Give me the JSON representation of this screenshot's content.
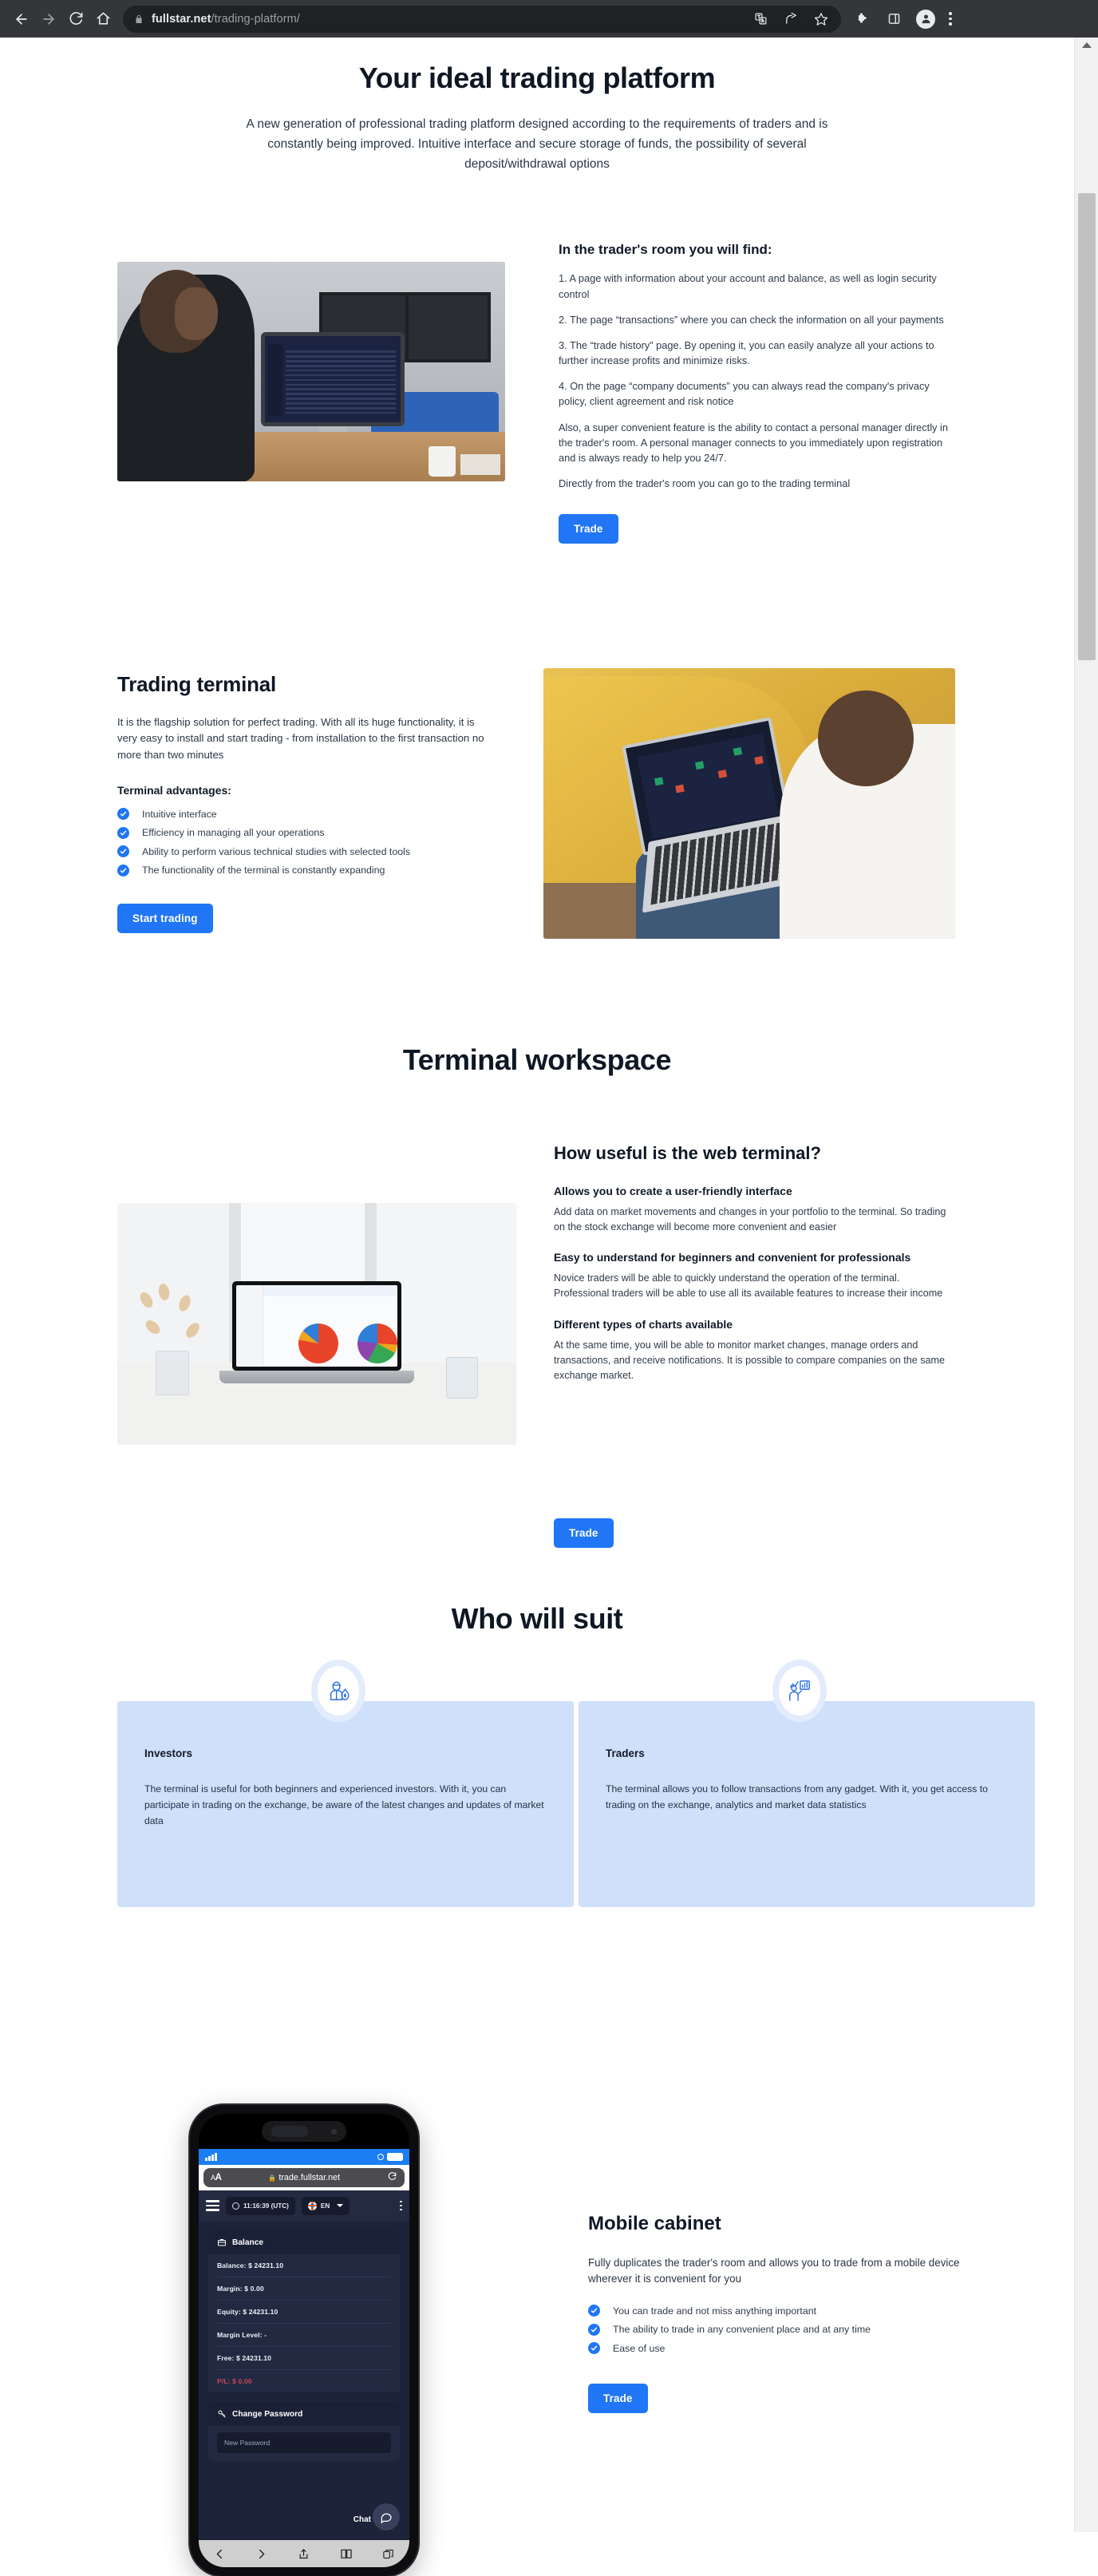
{
  "browser": {
    "back_icon": "arrow-left-icon",
    "forward_icon": "arrow-right-icon",
    "reload_icon": "reload-icon",
    "home_icon": "home-icon",
    "lock_icon": "lock-icon",
    "url_host": "fullstar.net",
    "url_path": "/trading-platform/",
    "toolbar_icons": [
      "translate-icon",
      "share-icon",
      "bookmark-star-icon",
      "extensions-puzzle-icon",
      "side-panel-icon",
      "profile-avatar-icon",
      "browser-menu-icon"
    ]
  },
  "hero": {
    "title": "Your ideal trading platform",
    "subtitle": "A new generation of professional trading platform designed according to the requirements of traders and is constantly being improved. Intuitive interface and secure storage of funds, the possibility of several deposit/withdrawal options"
  },
  "traders_room": {
    "image_alt": "man-at-desk-with-trading-terminal-photo",
    "heading": "In the trader's room you will find:",
    "paragraphs": [
      "1. A page with information about your account and balance, as well as login security control",
      "2. The page “transactions” where you can check the information on all your payments",
      "3. The “trade history” page. By opening it, you can easily analyze all your actions to further increase profits and minimize risks.",
      "4. On the page “company documents” you can always read the company's privacy policy, client agreement and risk notice",
      "Also, a super convenient feature is the ability to contact a personal manager directly in the trader's room. A personal manager connects to you immediately upon registration and is always ready to help you 24/7.",
      "Directly from the trader's room you can go to the trading terminal"
    ],
    "cta": "Trade"
  },
  "trading_terminal": {
    "title": "Trading terminal",
    "description": "It is the flagship solution for perfect trading. With all its huge functionality, it is very easy to install and start trading - from installation to the first transaction no more than two minutes",
    "advantages_title": "Terminal advantages:",
    "advantages": [
      "Intuitive interface",
      "Efficiency in managing all your operations",
      "Ability to perform various technical studies with selected tools",
      "The functionality of the terminal is constantly expanding"
    ],
    "cta": "Start trading",
    "image_alt": "boy-on-bed-with-laptop-trading-charts-photo"
  },
  "workspace": {
    "title": "Terminal workspace",
    "image_alt": "laptop-on-desk-with-pie-charts-photo",
    "subtitle": "How useful is the web terminal?",
    "blocks": [
      {
        "heading": "Allows you to create a user-friendly interface",
        "body": "Add data on market movements and changes in your portfolio to the terminal. So trading on the stock exchange will become more convenient and easier"
      },
      {
        "heading": "Easy to understand for beginners and convenient for professionals",
        "body": "Novice traders will be able to quickly understand the operation of the terminal. Professional traders will be able to use all its available features to increase their income"
      },
      {
        "heading": "Different types of charts available",
        "body": "At the same time, you will be able to monitor market changes, manage orders and transactions, and receive notifications. It is possible to compare companies on the same exchange market."
      }
    ],
    "cta": "Trade"
  },
  "who_will_suit": {
    "title": "Who will suit",
    "cards": [
      {
        "icon": "investor-person-with-money-bag-icon",
        "title": "Investors",
        "body": "The terminal is useful for both beginners and experienced investors. With it, you can participate in trading on the exchange, be aware of the latest changes and updates of market data"
      },
      {
        "icon": "trader-person-with-chart-icon",
        "title": "Traders",
        "body": "The terminal allows you to follow transactions from any gadget. With it, you get access to trading on the exchange, analytics and market data statistics"
      }
    ]
  },
  "mobile_cabinet": {
    "title": "Mobile cabinet",
    "description": "Fully duplicates the trader's room and allows you to trade from a mobile device wherever it is convenient for you",
    "bullets": [
      "You can trade and not miss anything important",
      "The ability to trade in any convenient place and at any time",
      "Ease of use"
    ],
    "cta": "Trade"
  },
  "phone": {
    "ios_url": "trade.fullstar.net",
    "ios_aa_label": "AA",
    "app": {
      "clock": "11:16:39 (UTC)",
      "language": "EN",
      "balance_panel_title": "Balance",
      "rows": [
        {
          "label": "Balance:",
          "value": "$ 24231.10"
        },
        {
          "label": "Margin:",
          "value": "$ 0.00"
        },
        {
          "label": "Equity:",
          "value": "$ 24231.10"
        },
        {
          "label": "Margin Level:",
          "value": "-"
        },
        {
          "label": "Free:",
          "value": "$ 24231.10"
        },
        {
          "label": "P/L:",
          "value": "$ 0.00"
        }
      ],
      "change_password_title": "Change Password",
      "new_password_placeholder": "New Password",
      "chat_label": "Chat"
    },
    "colors": {
      "accent": "#2076f4",
      "pl_red": "#cf4455",
      "app_bg": "#1d2338"
    }
  },
  "theme": {
    "accent": "#2076f4",
    "card_bg": "#cfe0fb",
    "text": "#1a2330"
  }
}
